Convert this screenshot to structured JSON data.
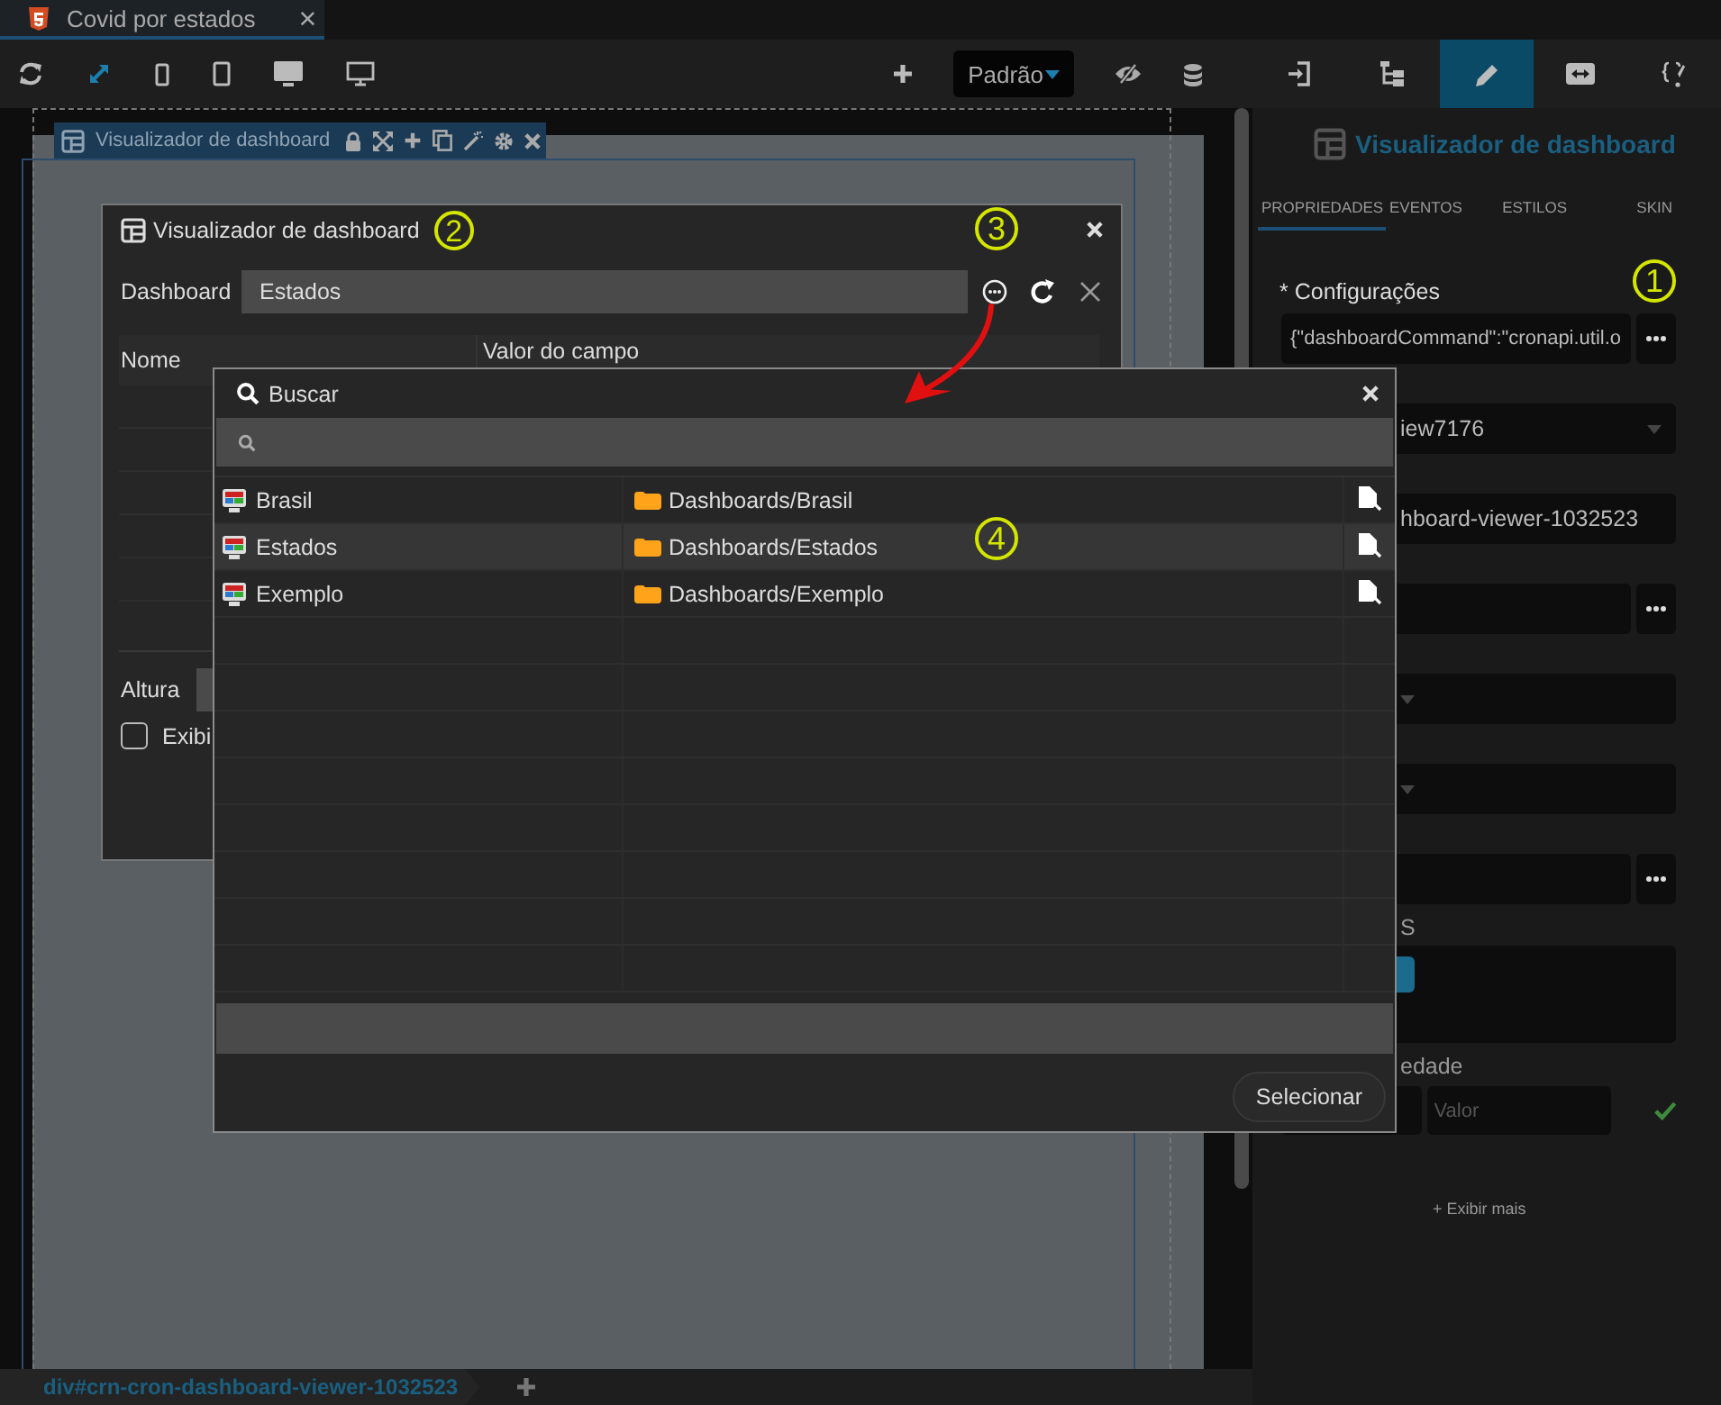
{
  "tab": {
    "title": "Covid por estados",
    "close": "×"
  },
  "toolbar": {
    "preset": "Padrão"
  },
  "panel_tabs": [
    {
      "selected": false
    },
    {
      "selected": false
    },
    {
      "selected": true
    },
    {
      "selected": false
    },
    {
      "selected": false
    }
  ],
  "component_bar": {
    "title": "Visualizador de dashboard"
  },
  "dashboard_dialog": {
    "title": "Visualizador de dashboard",
    "title_annotation": "2",
    "field_label": "Dashboard",
    "field_value": "Estados",
    "field_annotation": "3",
    "columns": [
      "Nome",
      "Valor do campo"
    ],
    "height_label": "Altura",
    "checkbox": {
      "label": "Exibi",
      "checked": false
    }
  },
  "search_dialog": {
    "title": "Buscar",
    "rows": [
      {
        "name": "Brasil",
        "path": "Dashboards/Brasil",
        "selected": false
      },
      {
        "name": "Estados",
        "path": "Dashboards/Estados",
        "selected": true
      },
      {
        "name": "Exemplo",
        "path": "Dashboards/Exemplo",
        "selected": false
      }
    ],
    "annotation": "4",
    "button": "Selecionar"
  },
  "properties": {
    "title": "Visualizador de dashboard",
    "tabs": [
      {
        "label": "PROPRIEDADES",
        "selected": true
      },
      {
        "label": "EVENTOS",
        "selected": false
      },
      {
        "label": "ESTILOS",
        "selected": false
      },
      {
        "label": "SKIN",
        "selected": false
      }
    ],
    "config_label": "* Configurações",
    "config_value": "{\"dashboardCommand\":\"cronapi.util.o",
    "config_annotation": "1",
    "fields": [
      {
        "kind": "select",
        "value": "iew7176"
      },
      {
        "kind": "text",
        "value": "hboard-viewer-1032523"
      },
      {
        "kind": "more"
      },
      {
        "kind": "select"
      },
      {
        "kind": "select"
      },
      {
        "kind": "more"
      },
      {
        "kind": "label",
        "text": "S"
      },
      {
        "kind": "tags"
      },
      {
        "kind": "label",
        "text": "edade"
      },
      {
        "kind": "pair",
        "placeholder": "Valor"
      }
    ],
    "more_link": "+ Exibir mais"
  },
  "breadcrumb": {
    "path": "div#crn-cron-dashboard-viewer-1032523"
  }
}
